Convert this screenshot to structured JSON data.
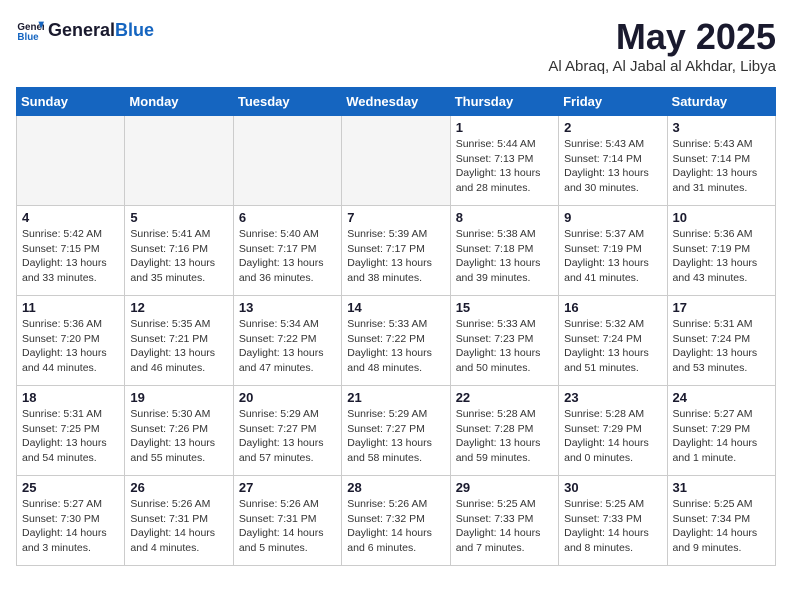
{
  "header": {
    "logo_general": "General",
    "logo_blue": "Blue",
    "month_title": "May 2025",
    "location": "Al Abraq, Al Jabal al Akhdar, Libya"
  },
  "weekdays": [
    "Sunday",
    "Monday",
    "Tuesday",
    "Wednesday",
    "Thursday",
    "Friday",
    "Saturday"
  ],
  "weeks": [
    [
      {
        "day": "",
        "info": "",
        "empty": true
      },
      {
        "day": "",
        "info": "",
        "empty": true
      },
      {
        "day": "",
        "info": "",
        "empty": true
      },
      {
        "day": "",
        "info": "",
        "empty": true
      },
      {
        "day": "1",
        "info": "Sunrise: 5:44 AM\nSunset: 7:13 PM\nDaylight: 13 hours\nand 28 minutes."
      },
      {
        "day": "2",
        "info": "Sunrise: 5:43 AM\nSunset: 7:14 PM\nDaylight: 13 hours\nand 30 minutes."
      },
      {
        "day": "3",
        "info": "Sunrise: 5:43 AM\nSunset: 7:14 PM\nDaylight: 13 hours\nand 31 minutes."
      }
    ],
    [
      {
        "day": "4",
        "info": "Sunrise: 5:42 AM\nSunset: 7:15 PM\nDaylight: 13 hours\nand 33 minutes."
      },
      {
        "day": "5",
        "info": "Sunrise: 5:41 AM\nSunset: 7:16 PM\nDaylight: 13 hours\nand 35 minutes."
      },
      {
        "day": "6",
        "info": "Sunrise: 5:40 AM\nSunset: 7:17 PM\nDaylight: 13 hours\nand 36 minutes."
      },
      {
        "day": "7",
        "info": "Sunrise: 5:39 AM\nSunset: 7:17 PM\nDaylight: 13 hours\nand 38 minutes."
      },
      {
        "day": "8",
        "info": "Sunrise: 5:38 AM\nSunset: 7:18 PM\nDaylight: 13 hours\nand 39 minutes."
      },
      {
        "day": "9",
        "info": "Sunrise: 5:37 AM\nSunset: 7:19 PM\nDaylight: 13 hours\nand 41 minutes."
      },
      {
        "day": "10",
        "info": "Sunrise: 5:36 AM\nSunset: 7:19 PM\nDaylight: 13 hours\nand 43 minutes."
      }
    ],
    [
      {
        "day": "11",
        "info": "Sunrise: 5:36 AM\nSunset: 7:20 PM\nDaylight: 13 hours\nand 44 minutes."
      },
      {
        "day": "12",
        "info": "Sunrise: 5:35 AM\nSunset: 7:21 PM\nDaylight: 13 hours\nand 46 minutes."
      },
      {
        "day": "13",
        "info": "Sunrise: 5:34 AM\nSunset: 7:22 PM\nDaylight: 13 hours\nand 47 minutes."
      },
      {
        "day": "14",
        "info": "Sunrise: 5:33 AM\nSunset: 7:22 PM\nDaylight: 13 hours\nand 48 minutes."
      },
      {
        "day": "15",
        "info": "Sunrise: 5:33 AM\nSunset: 7:23 PM\nDaylight: 13 hours\nand 50 minutes."
      },
      {
        "day": "16",
        "info": "Sunrise: 5:32 AM\nSunset: 7:24 PM\nDaylight: 13 hours\nand 51 minutes."
      },
      {
        "day": "17",
        "info": "Sunrise: 5:31 AM\nSunset: 7:24 PM\nDaylight: 13 hours\nand 53 minutes."
      }
    ],
    [
      {
        "day": "18",
        "info": "Sunrise: 5:31 AM\nSunset: 7:25 PM\nDaylight: 13 hours\nand 54 minutes."
      },
      {
        "day": "19",
        "info": "Sunrise: 5:30 AM\nSunset: 7:26 PM\nDaylight: 13 hours\nand 55 minutes."
      },
      {
        "day": "20",
        "info": "Sunrise: 5:29 AM\nSunset: 7:27 PM\nDaylight: 13 hours\nand 57 minutes."
      },
      {
        "day": "21",
        "info": "Sunrise: 5:29 AM\nSunset: 7:27 PM\nDaylight: 13 hours\nand 58 minutes."
      },
      {
        "day": "22",
        "info": "Sunrise: 5:28 AM\nSunset: 7:28 PM\nDaylight: 13 hours\nand 59 minutes."
      },
      {
        "day": "23",
        "info": "Sunrise: 5:28 AM\nSunset: 7:29 PM\nDaylight: 14 hours\nand 0 minutes."
      },
      {
        "day": "24",
        "info": "Sunrise: 5:27 AM\nSunset: 7:29 PM\nDaylight: 14 hours\nand 1 minute."
      }
    ],
    [
      {
        "day": "25",
        "info": "Sunrise: 5:27 AM\nSunset: 7:30 PM\nDaylight: 14 hours\nand 3 minutes."
      },
      {
        "day": "26",
        "info": "Sunrise: 5:26 AM\nSunset: 7:31 PM\nDaylight: 14 hours\nand 4 minutes."
      },
      {
        "day": "27",
        "info": "Sunrise: 5:26 AM\nSunset: 7:31 PM\nDaylight: 14 hours\nand 5 minutes."
      },
      {
        "day": "28",
        "info": "Sunrise: 5:26 AM\nSunset: 7:32 PM\nDaylight: 14 hours\nand 6 minutes."
      },
      {
        "day": "29",
        "info": "Sunrise: 5:25 AM\nSunset: 7:33 PM\nDaylight: 14 hours\nand 7 minutes."
      },
      {
        "day": "30",
        "info": "Sunrise: 5:25 AM\nSunset: 7:33 PM\nDaylight: 14 hours\nand 8 minutes."
      },
      {
        "day": "31",
        "info": "Sunrise: 5:25 AM\nSunset: 7:34 PM\nDaylight: 14 hours\nand 9 minutes."
      }
    ]
  ]
}
